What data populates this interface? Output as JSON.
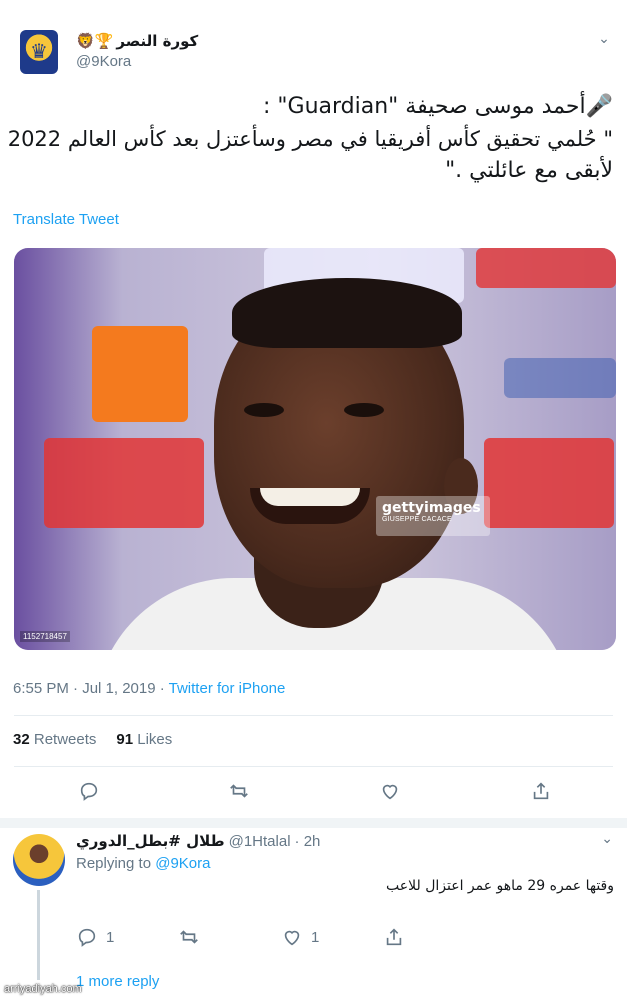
{
  "tweet": {
    "account_name": "كورة النصر",
    "name_emojis": "🦁🏆",
    "handle": "@9Kora",
    "avatar_icon": "lion-crest-icon",
    "body_lines": [
      "🎤أحمد موسى صحيفة \"Guardian\" :",
      "\" حُلمي تحقيق كأس أفريقيا في مصر وسأعتزل بعد كأس العالم 2022",
      "لأبقى مع عائلتي .\""
    ],
    "translate_label": "Translate Tweet",
    "photo": {
      "watermark_brand": "gettyimages",
      "watermark_credit": "GIUSEPPE CACACE",
      "image_id": "1152718457"
    },
    "time": "6:55 PM · Jul 1, 2019 · ",
    "source": "Twitter for iPhone",
    "retweets_count": "32",
    "retweets_label": "Retweets",
    "likes_count": "91",
    "likes_label": "Likes"
  },
  "reply": {
    "name": "طلال #بطل_الدوري",
    "handle": "@1Htalal",
    "time": "· 2h",
    "replying_prefix": "Replying to",
    "replying_to": "@9Kora",
    "text": "وقتها عمره 29 ماهو عمر اعتزال للاعب",
    "reply_count": "1",
    "like_count": "1",
    "more_replies": "1 more reply"
  },
  "site_watermark": "arriyadiyah.com",
  "colors": {
    "accent": "#1da1f2",
    "muted": "#657786",
    "text": "#14171a"
  }
}
